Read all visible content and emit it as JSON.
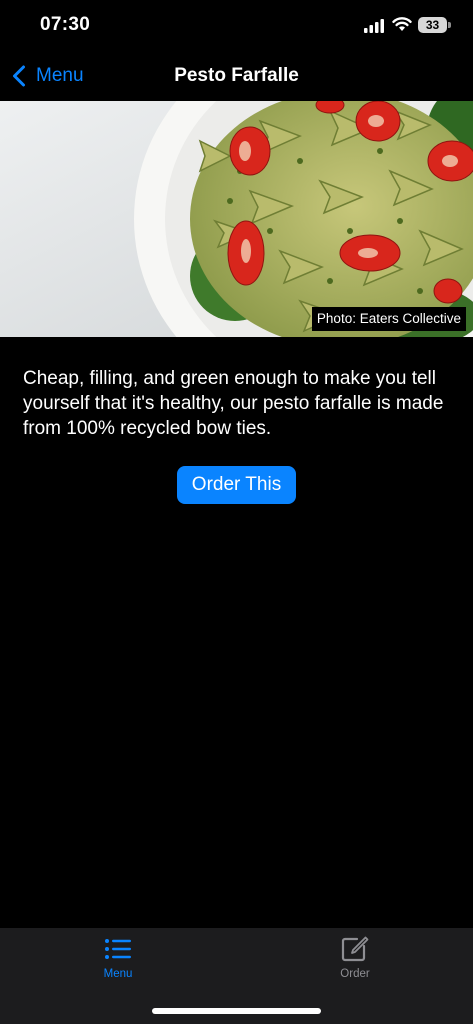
{
  "status_bar": {
    "time": "07:30",
    "battery_level": "33",
    "icons": [
      "cellular-signal-icon",
      "wifi-icon",
      "battery-icon"
    ]
  },
  "nav": {
    "back_label": "Menu",
    "back_icon": "chevron-left-icon",
    "title": "Pesto Farfalle"
  },
  "hero": {
    "photo_credit": "Photo: Eaters Collective"
  },
  "content": {
    "description": "Cheap, filling, and green enough to make you tell yourself that it's healthy, our pesto farfalle is made from 100% recycled bow ties.",
    "order_button_label": "Order This"
  },
  "tab_bar": {
    "tabs": [
      {
        "label": "Menu",
        "icon": "list-icon",
        "selected": true
      },
      {
        "label": "Order",
        "icon": "compose-icon",
        "selected": false
      }
    ]
  },
  "colors": {
    "accent": "#0a84ff",
    "background": "#000000",
    "tab_bar_background": "#1c1c1e",
    "inactive_tab": "#8e8e93"
  }
}
